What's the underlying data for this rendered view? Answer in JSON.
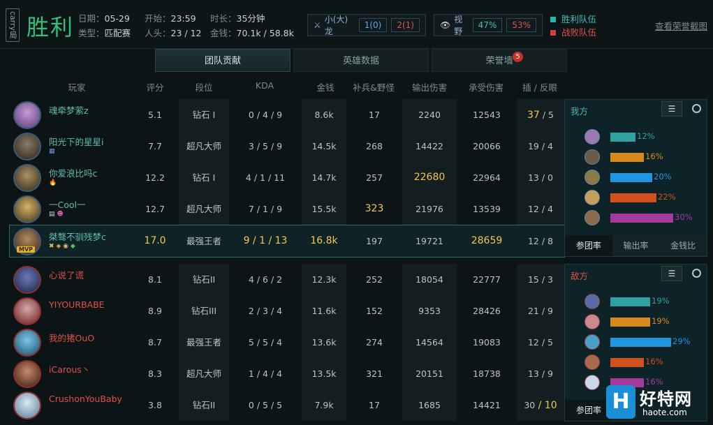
{
  "header": {
    "carry": "carry局",
    "result": "胜利",
    "date_label": "日期：",
    "date": "05-29",
    "type_label": "类型：",
    "type": "匹配赛",
    "start_label": "开始：",
    "start": "23:59",
    "kills_label": "人头：",
    "kills": "23 / 12",
    "duration_label": "时长：",
    "duration": "35分钟",
    "gold_label": "金钱：",
    "gold": "70.1k / 58.8k",
    "dragon_label": "小(大)龙",
    "dragon_win": "1(0)",
    "dragon_lose": "2(1)",
    "vision_label": "视野",
    "vision_win": "47%",
    "vision_lose": "53%",
    "legend_win": "胜利队伍",
    "legend_lose": "战败队伍",
    "screenshot_link": "查看荣誉截图",
    "colors": {
      "win": "#2bb3a6",
      "lose": "#d0403c",
      "accent": "#f3c74e"
    }
  },
  "tabs": [
    {
      "label": "团队贡献"
    },
    {
      "label": "英雄数据"
    },
    {
      "label": "荣誉墙",
      "badge": "5"
    }
  ],
  "columns": [
    "玩家",
    "评分",
    "段位",
    "KDA",
    "金钱",
    "补兵&野怪",
    "输出伤害",
    "承受伤害",
    "插 / 反眼"
  ],
  "teams": {
    "ally": [
      {
        "name": "魂牵梦萦z",
        "score": "5.1",
        "rank": "钻石 I",
        "kda": "0 / 4 / 9",
        "gold": "8.6k",
        "cs": "17",
        "dmg": "2240",
        "taken": "12543",
        "ward": "37",
        "ward2": " / 5"
      },
      {
        "name": "阳光下的星星i",
        "score": "7.7",
        "rank": "超凡大师",
        "kda": "3 / 5 / 9",
        "gold": "14.5k",
        "cs": "268",
        "dmg": "14422",
        "taken": "20066",
        "ward": "19",
        "ward2": " / 4"
      },
      {
        "name": "你爱浪比吗c",
        "score": "12.2",
        "rank": "钻石 I",
        "kda": "4 / 1 / 11",
        "gold": "14.7k",
        "cs": "257",
        "dmg": "22680",
        "taken": "22964",
        "ward": "13",
        "ward2": " / 0"
      },
      {
        "name": "一Cool一",
        "score": "12.7",
        "rank": "超凡大师",
        "kda": "7 / 1 / 9",
        "gold": "15.5k",
        "cs": "323",
        "dmg": "21976",
        "taken": "13539",
        "ward": "12",
        "ward2": " / 4"
      },
      {
        "name": "桀骜不驯残梦c",
        "score": "17.0",
        "rank": "最强王者",
        "kda": "9 / 1 / 13",
        "gold": "16.8k",
        "cs": "197",
        "dmg": "19721",
        "taken": "28659",
        "ward": "12",
        "ward2": " / 8",
        "mvp": "MVP"
      }
    ],
    "enemy": [
      {
        "name": "心说了谎",
        "score": "8.1",
        "rank": "钻石II",
        "kda": "4 / 6 / 2",
        "gold": "12.3k",
        "cs": "252",
        "dmg": "18054",
        "taken": "22777",
        "ward": "15",
        "ward2": " / 3"
      },
      {
        "name": "YIYOURBABE",
        "score": "8.9",
        "rank": "钻石III",
        "kda": "2 / 3 / 4",
        "gold": "11.6k",
        "cs": "152",
        "dmg": "9353",
        "taken": "28426",
        "ward": "21",
        "ward2": " / 9"
      },
      {
        "name": "我的猪OuO",
        "score": "8.7",
        "rank": "最强王者",
        "kda": "5 / 5 / 4",
        "gold": "13.6k",
        "cs": "274",
        "dmg": "14564",
        "taken": "19083",
        "ward": "12",
        "ward2": " / 5"
      },
      {
        "name": "iCarous丶",
        "score": "8.3",
        "rank": "超凡大师",
        "kda": "1 / 4 / 4",
        "gold": "13.5k",
        "cs": "321",
        "dmg": "20151",
        "taken": "18738",
        "ward": "13",
        "ward2": " / 9"
      },
      {
        "name": "CrushonYouBaby",
        "score": "3.8",
        "rank": "钻石II",
        "kda": "0 / 5 / 5",
        "gold": "7.9k",
        "cs": "17",
        "dmg": "1685",
        "taken": "14421",
        "ward": "30",
        "ward2": " / 10"
      }
    ]
  },
  "ally_panel": {
    "title": "我方",
    "bars": [
      {
        "pct": "12%",
        "value": 12,
        "color": "#2fa1a0"
      },
      {
        "pct": "16%",
        "value": 16,
        "color": "#d98a1c"
      },
      {
        "pct": "20%",
        "value": 20,
        "color": "#1f95e0"
      },
      {
        "pct": "22%",
        "value": 22,
        "color": "#d2501e"
      },
      {
        "pct": "30%",
        "value": 30,
        "color": "#a43a9c"
      }
    ],
    "tabs": [
      "参团率",
      "输出率",
      "金钱比"
    ]
  },
  "enemy_panel": {
    "title": "敌方",
    "bars": [
      {
        "pct": "19%",
        "value": 19,
        "color": "#2fa1a0"
      },
      {
        "pct": "19%",
        "value": 19,
        "color": "#d98a1c"
      },
      {
        "pct": "29%",
        "value": 29,
        "color": "#1f95e0"
      },
      {
        "pct": "16%",
        "value": 16,
        "color": "#d2501e"
      },
      {
        "pct": "16%",
        "value": 16,
        "color": "#a43a9c"
      }
    ],
    "tab": "参团率"
  },
  "watermark": {
    "logo": "H",
    "text": "好特网",
    "url": "haote.com"
  }
}
